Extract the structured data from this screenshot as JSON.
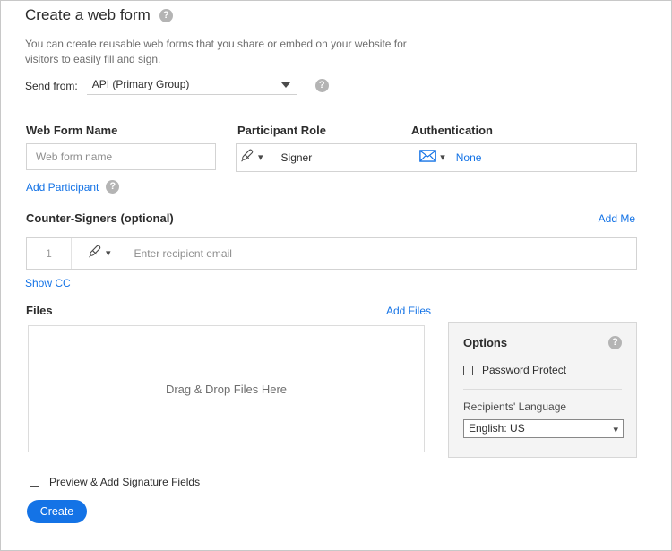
{
  "header": {
    "title": "Create a web form",
    "help_icon": "help-circle-icon",
    "description": "You can create reusable web forms that you share or embed on your website for visitors to easily fill and sign."
  },
  "send_from": {
    "label": "Send from:",
    "value": "API (Primary Group)",
    "help_icon": "help-circle-icon"
  },
  "columns": {
    "web_form_name": "Web Form Name",
    "participant_role": "Participant Role",
    "authentication": "Authentication"
  },
  "web_form_name_input": {
    "value": "",
    "placeholder": "Web form name"
  },
  "participant": {
    "role_icon": "pen-signature-icon",
    "role_chevron": "chevron-down-icon",
    "role": "Signer",
    "auth_icon": "envelope-icon",
    "auth_chevron": "chevron-down-icon",
    "auth": "None"
  },
  "add_participant": {
    "label": "Add Participant",
    "help_icon": "help-circle-icon"
  },
  "counter_signers": {
    "label": "Counter-Signers (optional)",
    "add_me": "Add Me",
    "row": {
      "index": "1",
      "role_icon": "pen-signature-icon",
      "role_chevron": "chevron-down-icon",
      "email_value": "",
      "email_placeholder": "Enter recipient email"
    },
    "show_cc": "Show CC"
  },
  "files": {
    "label": "Files",
    "add_files": "Add Files",
    "dropzone_text": "Drag & Drop Files Here"
  },
  "options": {
    "title": "Options",
    "help_icon": "help-circle-icon",
    "password_protect": {
      "label": "Password Protect",
      "checked": false
    },
    "language": {
      "label": "Recipients' Language",
      "value": "English: US",
      "chevron": "chevron-down-icon"
    }
  },
  "footer": {
    "preview_label": "Preview & Add Signature Fields",
    "preview_checked": false,
    "create_label": "Create"
  },
  "colors": {
    "accent_blue": "#1473e6",
    "link_blue": "#1473e6",
    "text": "#2c2c2c",
    "muted_text": "#6e6e6e",
    "placeholder": "#8e8e8e",
    "panel_bg": "#f4f4f4",
    "border": "#d3d3d3"
  }
}
